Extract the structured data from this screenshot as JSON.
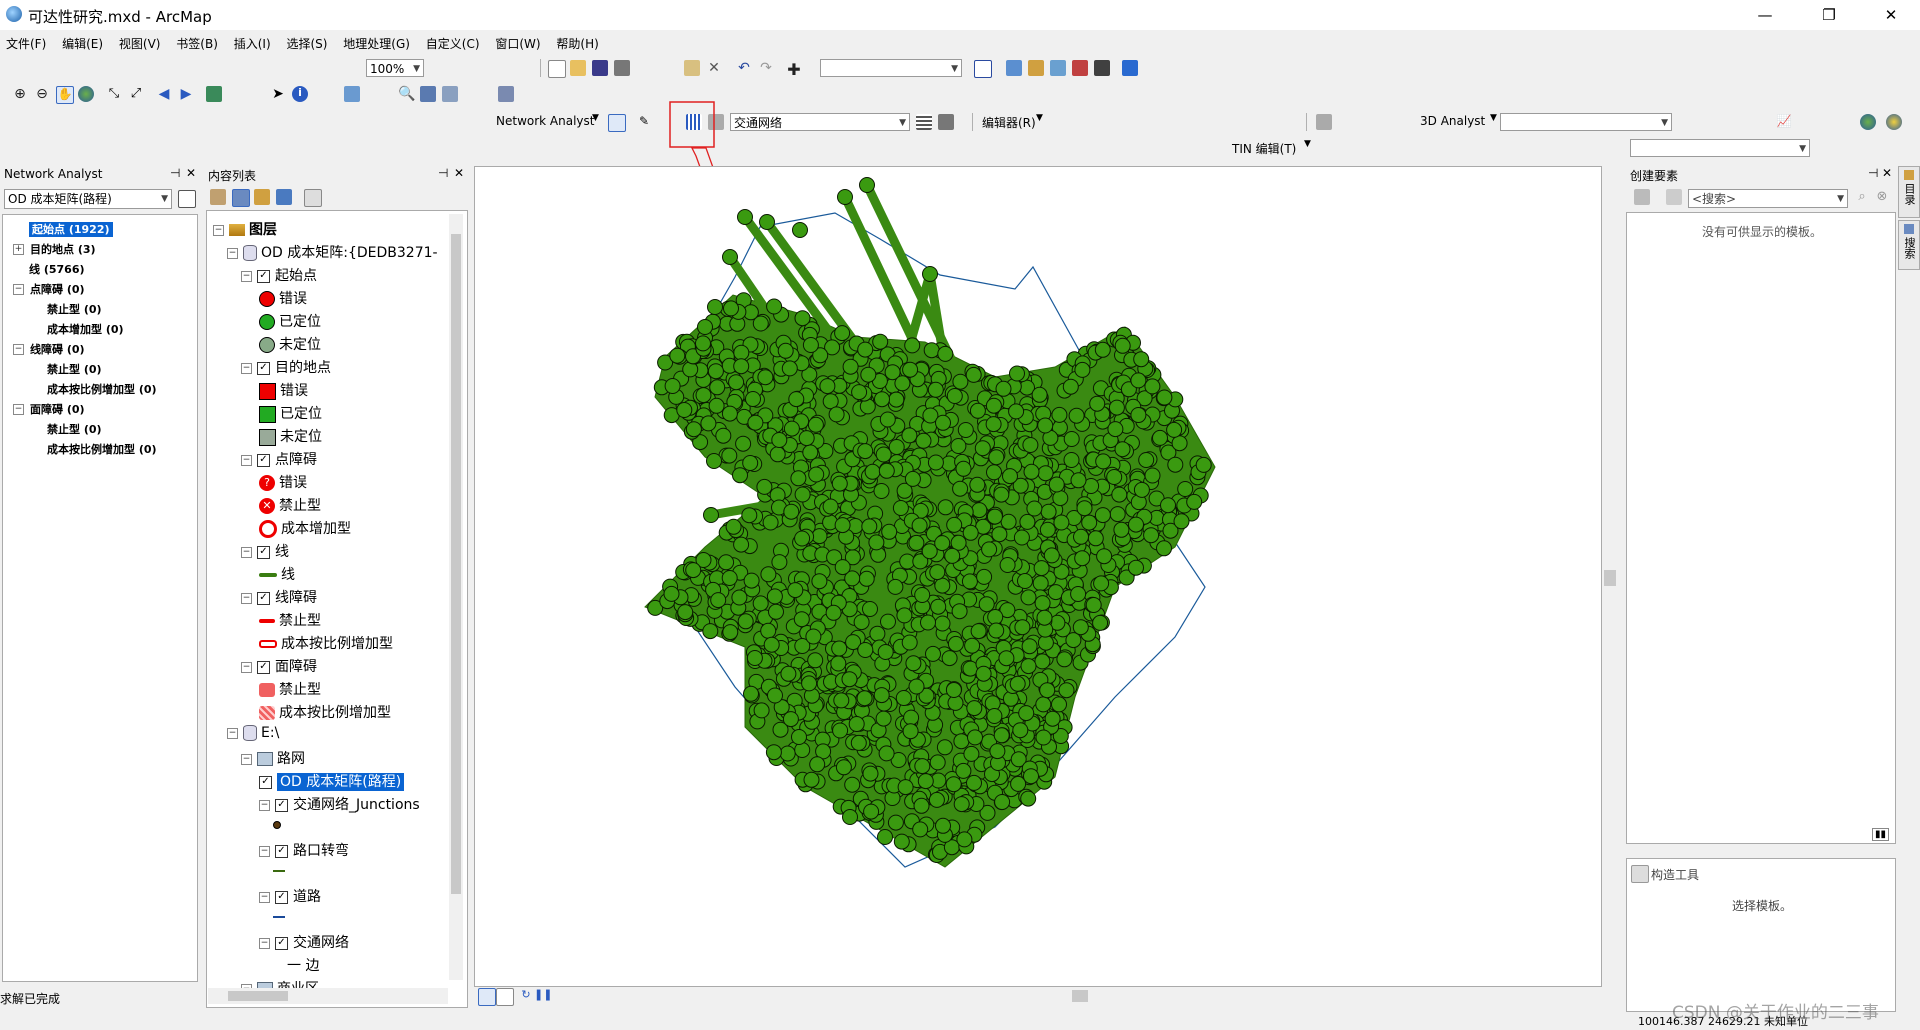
{
  "window": {
    "title": "可达性研究.mxd - ArcMap",
    "minimize": "—",
    "restore": "❐",
    "close": "✕"
  },
  "menu": [
    "文件(F)",
    "编辑(E)",
    "视图(V)",
    "书签(B)",
    "插入(I)",
    "选择(S)",
    "地理处理(G)",
    "自定义(C)",
    "窗口(W)",
    "帮助(H)"
  ],
  "toolbar": {
    "zoom_value": "100%",
    "network_analyst_label": "Network Analyst",
    "network_dataset": "交通网络",
    "editor_label": "编辑器(R)",
    "analyst3d_label": "3D Analyst",
    "tin_label": "TIN 编辑(T)"
  },
  "network_analyst_window": {
    "title": "Network Analyst",
    "dropdown_value": "OD 成本矩阵(路程)",
    "items": [
      {
        "label": "起始点 (1922)",
        "level": 0,
        "expand": "",
        "bold": true,
        "selected": true
      },
      {
        "label": "目的地点 (3)",
        "level": 0,
        "expand": "+",
        "bold": true
      },
      {
        "label": "线 (5766)",
        "level": 0,
        "expand": "",
        "bold": true
      },
      {
        "label": "点障碍 (0)",
        "level": 0,
        "expand": "−",
        "bold": true
      },
      {
        "label": "禁止型 (0)",
        "level": 1,
        "bold": true
      },
      {
        "label": "成本增加型 (0)",
        "level": 1,
        "bold": true
      },
      {
        "label": "线障碍 (0)",
        "level": 0,
        "expand": "−",
        "bold": true
      },
      {
        "label": "禁止型 (0)",
        "level": 1,
        "bold": true
      },
      {
        "label": "成本按比例增加型 (0)",
        "level": 1,
        "bold": true
      },
      {
        "label": "面障碍 (0)",
        "level": 0,
        "expand": "−",
        "bold": true
      },
      {
        "label": "禁止型 (0)",
        "level": 1,
        "bold": true
      },
      {
        "label": "成本按比例增加型 (0)",
        "level": 1,
        "bold": true
      }
    ]
  },
  "toc": {
    "title": "内容列表",
    "rows": [
      {
        "label": "图层",
        "indent": 0,
        "expand": "−",
        "icon": "layers",
        "bold": true
      },
      {
        "label": "OD 成本矩阵:{DEDB3271-",
        "indent": 1,
        "expand": "−",
        "icon": "cylinder"
      },
      {
        "label": "起始点",
        "indent": 2,
        "expand": "−",
        "check": true
      },
      {
        "label": "错误",
        "indent": 3,
        "icon": "circle-red"
      },
      {
        "label": "已定位",
        "indent": 3,
        "icon": "circle-green"
      },
      {
        "label": "未定位",
        "indent": 3,
        "icon": "circle-unlocated"
      },
      {
        "label": "目的地点",
        "indent": 2,
        "expand": "−",
        "check": true
      },
      {
        "label": "错误",
        "indent": 3,
        "icon": "square-red"
      },
      {
        "label": "已定位",
        "indent": 3,
        "icon": "square-green"
      },
      {
        "label": "未定位",
        "indent": 3,
        "icon": "square-unlocated"
      },
      {
        "label": "点障碍",
        "indent": 2,
        "expand": "−",
        "check": true
      },
      {
        "label": "错误",
        "indent": 3,
        "icon": "barrier-error"
      },
      {
        "label": "禁止型",
        "indent": 3,
        "icon": "barrier-restrict"
      },
      {
        "label": "成本增加型",
        "indent": 3,
        "icon": "barrier-cost"
      },
      {
        "label": "线",
        "indent": 2,
        "expand": "−",
        "check": true
      },
      {
        "label": "线",
        "indent": 3,
        "icon": "line-green"
      },
      {
        "label": "线障碍",
        "indent": 2,
        "expand": "−",
        "check": true
      },
      {
        "label": "禁止型",
        "indent": 3,
        "icon": "line-red"
      },
      {
        "label": "成本按比例增加型",
        "indent": 3,
        "icon": "line-red-hollow"
      },
      {
        "label": "面障碍",
        "indent": 2,
        "expand": "−",
        "check": true
      },
      {
        "label": "禁止型",
        "indent": 3,
        "icon": "poly-red"
      },
      {
        "label": "成本按比例增加型",
        "indent": 3,
        "icon": "poly-red-hatch"
      },
      {
        "label": "E:\\",
        "indent": 1,
        "expand": "−",
        "icon": "cylinder"
      },
      {
        "label": "路网",
        "indent": 2,
        "expand": "−",
        "icon": "dataset"
      },
      {
        "label": "OD 成本矩阵(路程)",
        "indent": 3,
        "check": true,
        "selected": true
      },
      {
        "label": "交通网络_Junctions",
        "indent": 3,
        "expand": "−",
        "check": true
      },
      {
        "label": "",
        "indent": 4,
        "icon": "dot-black"
      },
      {
        "label": "路口转弯",
        "indent": 3,
        "expand": "−",
        "check": true
      },
      {
        "label": "",
        "indent": 4,
        "icon": "line-olive"
      },
      {
        "label": "道路",
        "indent": 3,
        "expand": "−",
        "check": true
      },
      {
        "label": "",
        "indent": 4,
        "icon": "line-blue"
      },
      {
        "label": "交通网络",
        "indent": 3,
        "expand": "−",
        "check": true
      },
      {
        "label": "一 边",
        "indent": 4
      },
      {
        "label": "商业区",
        "indent": 2,
        "expand": "−",
        "icon": "dataset"
      }
    ]
  },
  "create_features": {
    "title": "创建要素",
    "search_placeholder": "<搜索>",
    "empty_text": "没有可供显示的模板。",
    "construct_title": "构造工具",
    "construct_text": "选择模板。"
  },
  "side_tabs": [
    "目录",
    "搜索"
  ],
  "status": {
    "left": "求解已完成",
    "coords": "100146.387  24629.21 未知单位",
    "watermark": "CSDN @关于作业的二三事"
  }
}
